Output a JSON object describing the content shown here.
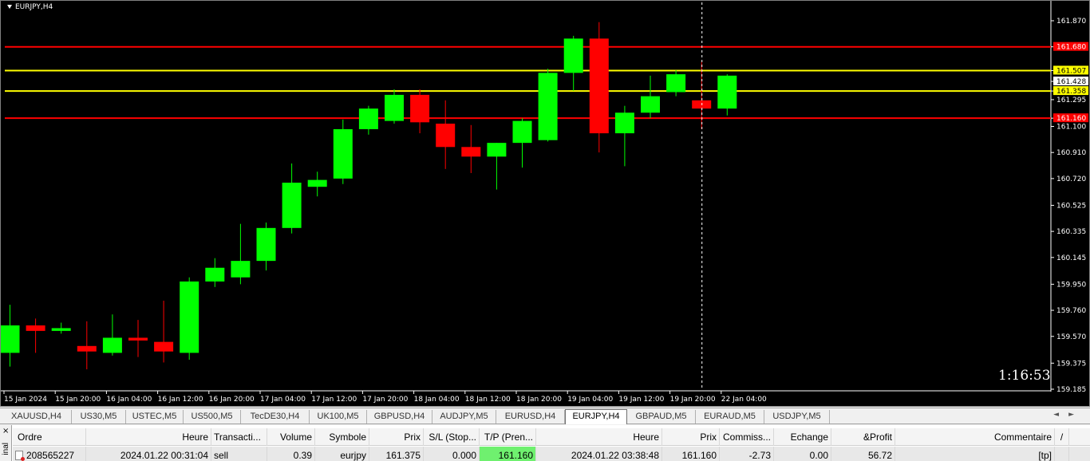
{
  "chart": {
    "title": "EURJPY,H4",
    "timer": "1:16:53",
    "y_labels": [
      "161.870",
      "161.680",
      "161.507",
      "161.428",
      "161.358",
      "161.295",
      "161.160",
      "161.100",
      "160.910",
      "160.720",
      "160.525",
      "160.335",
      "160.145",
      "159.950",
      "159.760",
      "159.570",
      "159.375",
      "159.185"
    ],
    "x_labels": [
      "15 Jan 2024",
      "15 Jan 20:00",
      "16 Jan 04:00",
      "16 Jan 12:00",
      "16 Jan 20:00",
      "17 Jan 04:00",
      "17 Jan 12:00",
      "17 Jan 20:00",
      "18 Jan 04:00",
      "18 Jan 12:00",
      "18 Jan 20:00",
      "19 Jan 04:00",
      "19 Jan 12:00",
      "19 Jan 20:00",
      "22 Jan 04:00"
    ],
    "colors": {
      "bull": "#00ff00",
      "bear": "#ff0000",
      "bg": "#000000",
      "axis_text": "#ffffff",
      "red_line": "#ff0000",
      "yellow_line": "#ffff00"
    }
  },
  "chart_data": {
    "type": "candlestick",
    "price_range": [
      159.185,
      161.935
    ],
    "candles": [
      {
        "o": 159.45,
        "h": 159.8,
        "l": 159.35,
        "c": 159.65
      },
      {
        "o": 159.65,
        "h": 159.7,
        "l": 159.45,
        "c": 159.61
      },
      {
        "o": 159.61,
        "h": 159.67,
        "l": 159.59,
        "c": 159.63
      },
      {
        "o": 159.5,
        "h": 159.68,
        "l": 159.33,
        "c": 159.46
      },
      {
        "o": 159.45,
        "h": 159.73,
        "l": 159.43,
        "c": 159.56
      },
      {
        "o": 159.56,
        "h": 159.69,
        "l": 159.42,
        "c": 159.54
      },
      {
        "o": 159.53,
        "h": 159.83,
        "l": 159.38,
        "c": 159.46
      },
      {
        "o": 159.45,
        "h": 160.0,
        "l": 159.4,
        "c": 159.97
      },
      {
        "o": 159.97,
        "h": 160.14,
        "l": 159.93,
        "c": 160.07
      },
      {
        "o": 160.0,
        "h": 160.39,
        "l": 159.95,
        "c": 160.12
      },
      {
        "o": 160.12,
        "h": 160.4,
        "l": 160.05,
        "c": 160.36
      },
      {
        "o": 160.36,
        "h": 160.83,
        "l": 160.32,
        "c": 160.69
      },
      {
        "o": 160.66,
        "h": 160.77,
        "l": 160.59,
        "c": 160.71
      },
      {
        "o": 160.72,
        "h": 161.15,
        "l": 160.68,
        "c": 161.08
      },
      {
        "o": 161.08,
        "h": 161.25,
        "l": 161.04,
        "c": 161.23
      },
      {
        "o": 161.14,
        "h": 161.37,
        "l": 161.12,
        "c": 161.33
      },
      {
        "o": 161.33,
        "h": 161.37,
        "l": 161.05,
        "c": 161.13
      },
      {
        "o": 161.12,
        "h": 161.29,
        "l": 160.79,
        "c": 160.95
      },
      {
        "o": 160.95,
        "h": 161.11,
        "l": 160.76,
        "c": 160.88
      },
      {
        "o": 160.88,
        "h": 160.98,
        "l": 160.64,
        "c": 160.98
      },
      {
        "o": 160.98,
        "h": 161.16,
        "l": 160.8,
        "c": 161.14
      },
      {
        "o": 161.0,
        "h": 161.52,
        "l": 160.99,
        "c": 161.49
      },
      {
        "o": 161.49,
        "h": 161.76,
        "l": 161.36,
        "c": 161.74
      },
      {
        "o": 161.74,
        "h": 161.86,
        "l": 160.91,
        "c": 161.05
      },
      {
        "o": 161.05,
        "h": 161.25,
        "l": 160.81,
        "c": 161.2
      },
      {
        "o": 161.2,
        "h": 161.47,
        "l": 161.16,
        "c": 161.32
      },
      {
        "o": 161.35,
        "h": 161.51,
        "l": 161.32,
        "c": 161.48
      },
      {
        "o": 161.29,
        "h": 161.57,
        "l": 161.08,
        "c": 161.23
      },
      {
        "o": 161.23,
        "h": 161.48,
        "l": 161.18,
        "c": 161.47
      }
    ],
    "h_lines": [
      {
        "price": 161.68,
        "color": "red"
      },
      {
        "price": 161.507,
        "color": "yellow"
      },
      {
        "price": 161.358,
        "color": "yellow"
      },
      {
        "price": 161.16,
        "color": "red"
      }
    ],
    "price_tags": [
      {
        "text": "161.680",
        "price": 161.68,
        "bg": "#ff0000",
        "fg": "#ffffff"
      },
      {
        "text": "161.507",
        "price": 161.507,
        "bg": "#ffff00",
        "fg": "#000000"
      },
      {
        "text": "161.428",
        "price": 161.428,
        "bg": "#ffffff",
        "fg": "#000000"
      },
      {
        "text": "161.358",
        "price": 161.358,
        "bg": "#ffff00",
        "fg": "#000000"
      },
      {
        "text": "161.160",
        "price": 161.16,
        "bg": "#ff0000",
        "fg": "#ffffff"
      }
    ],
    "crosshair_candle_index": 27
  },
  "tabs": {
    "items": [
      "XAUUSD,H4",
      "US30,M5",
      "USTEC,M5",
      "US500,M5",
      "TecDE30,H4",
      "UK100,M5",
      "GBPUSD,H4",
      "AUDJPY,M5",
      "EURUSD,H4",
      "EURJPY,H4",
      "GBPAUD,M5",
      "EURAUD,M5",
      "USDJPY,M5"
    ],
    "active": "EURJPY,H4",
    "arrows": "◄►"
  },
  "terminal": {
    "label": "inal",
    "close": "×",
    "headers": [
      "Ordre",
      "Heure",
      "Transacti...",
      "Volume",
      "Symbole",
      "Prix",
      "S/L (Stop...",
      "T/P (Pren...",
      "Heure",
      "Prix",
      "Commiss...",
      "Echange",
      "&Profit",
      "Commentaire",
      "/"
    ],
    "rows": [
      [
        "208565227",
        "2024.01.22 00:31:04",
        "sell",
        "0.39",
        "eurjpy",
        "161.375",
        "0.000",
        "161.160",
        "2024.01.22 03:38:48",
        "161.160",
        "-2.73",
        "0.00",
        "56.72",
        "[tp]",
        ""
      ]
    ]
  }
}
